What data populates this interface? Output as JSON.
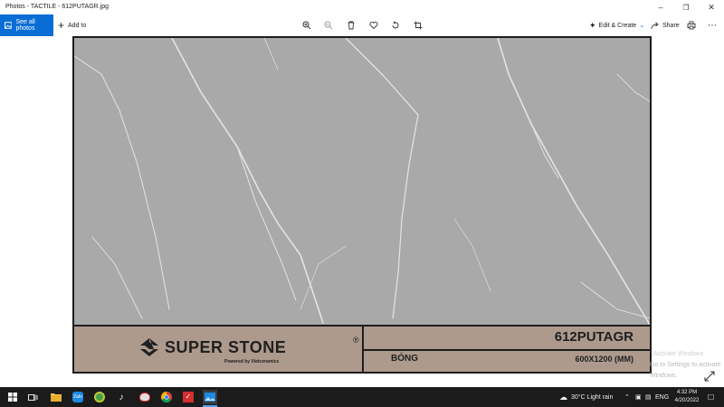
{
  "window": {
    "title": "Photos - TACTILE - 612PUTAGR.jpg"
  },
  "toolbar": {
    "see_all_label": "See all photos",
    "add_to_label": "Add to",
    "edit_create_label": "Edit & Create",
    "share_label": "Share",
    "icons": [
      "zoom-in-icon",
      "zoom-out-icon",
      "delete-icon",
      "heart-icon",
      "rotate-icon",
      "crop-icon",
      "print-icon",
      "more-icon"
    ]
  },
  "photo": {
    "brand_name": "SUPER STONE",
    "brand_reg": "®",
    "brand_sub": "Powered by Vietceramics",
    "product_code": "612PUTAGR",
    "finish": "BÓNG",
    "size": "600X1200 (MM)",
    "colors": {
      "marble": "#a9a9a9",
      "info_bar": "#ad9a8d",
      "border": "#1d1d1d"
    }
  },
  "watermark": {
    "line1": "Activate Windows",
    "line2": "Go to Settings to activate Windows."
  },
  "taskbar": {
    "weather": "30°C  Light rain",
    "language": "ENG",
    "time": "4:32 PM",
    "date": "4/20/2022"
  }
}
